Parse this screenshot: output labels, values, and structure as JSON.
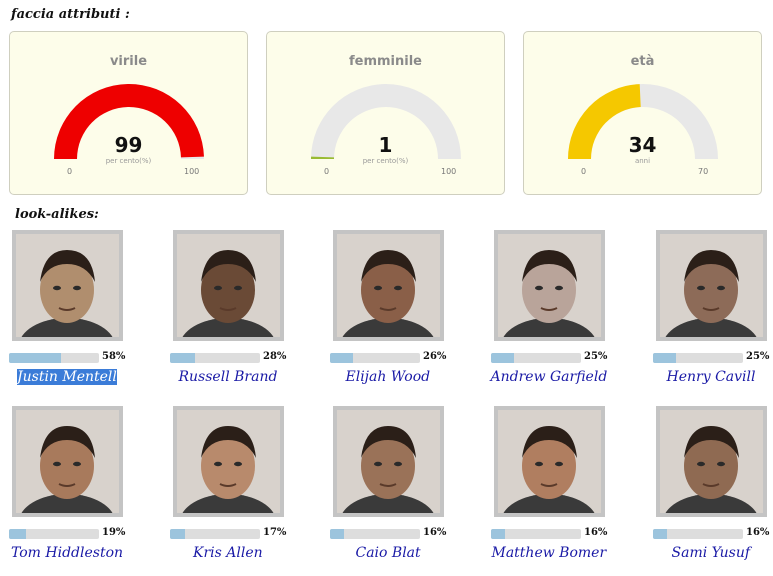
{
  "face_attributes": {
    "heading": "faccia attributi :",
    "gauges": [
      {
        "title": "virile",
        "value": "99",
        "unit": "per cento(%)",
        "min": "0",
        "max": "100",
        "level": 0.99,
        "color": "#ee0000"
      },
      {
        "title": "femminile",
        "value": "1",
        "unit": "per cento(%)",
        "min": "0",
        "max": "100",
        "level": 0.01,
        "color": "#99bb33"
      },
      {
        "title": "età",
        "value": "34",
        "unit": "anni",
        "min": "0",
        "max": "70",
        "level": 0.486,
        "color": "#f5c800"
      }
    ]
  },
  "lookalikes": {
    "heading": "look-alikes:",
    "items": [
      {
        "name": "Justin Mentell",
        "percent": "58%",
        "match": 0.58,
        "selected": true,
        "tone": "#b08e6e"
      },
      {
        "name": "Russell Brand",
        "percent": "28%",
        "match": 0.28,
        "selected": false,
        "tone": "#6a4a36"
      },
      {
        "name": "Elijah Wood",
        "percent": "26%",
        "match": 0.26,
        "selected": false,
        "tone": "#8a5f48"
      },
      {
        "name": "Andrew Garfield",
        "percent": "25%",
        "match": 0.25,
        "selected": false,
        "tone": "#b9a49a"
      },
      {
        "name": "Henry Cavill",
        "percent": "25%",
        "match": 0.25,
        "selected": false,
        "tone": "#8d6b58"
      },
      {
        "name": "Tom Hiddleston",
        "percent": "19%",
        "match": 0.19,
        "selected": false,
        "tone": "#a87a5c"
      },
      {
        "name": "Kris Allen",
        "percent": "17%",
        "match": 0.17,
        "selected": false,
        "tone": "#b88a6c"
      },
      {
        "name": "Caio Blat",
        "percent": "16%",
        "match": 0.16,
        "selected": false,
        "tone": "#9a7258"
      },
      {
        "name": "Matthew Bomer",
        "percent": "16%",
        "match": 0.16,
        "selected": false,
        "tone": "#b07e60"
      },
      {
        "name": "Sami Yusuf",
        "percent": "16%",
        "match": 0.16,
        "selected": false,
        "tone": "#8f6a52"
      }
    ]
  }
}
